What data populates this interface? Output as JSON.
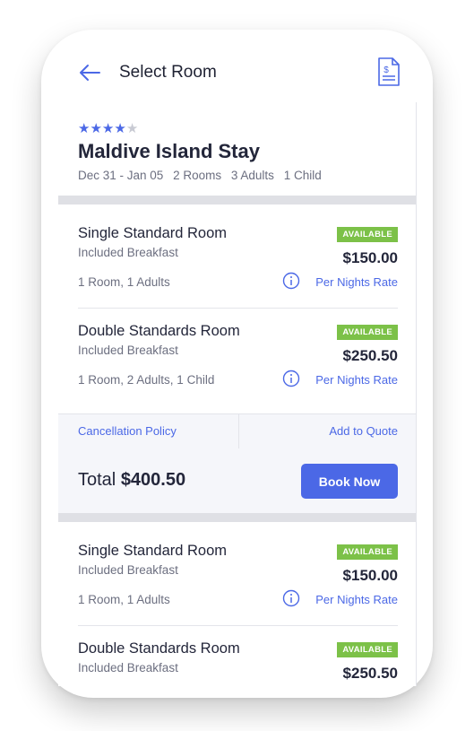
{
  "header": {
    "title": "Select Room"
  },
  "hotel": {
    "rating": 4,
    "max_rating": 5,
    "name": "Maldive Island Stay",
    "dates": "Dec 31 - Jan 05",
    "rooms": "2 Rooms",
    "adults": "3 Adults",
    "children": "1 Child"
  },
  "rooms": [
    {
      "name": "Single Standard Room",
      "sub": "Included Breakfast",
      "badge": "AVAILABLE",
      "price": "$150.00",
      "occupancy": "1 Room, 1 Adults",
      "rate_label": "Per Nights Rate"
    },
    {
      "name": "Double Standards Room",
      "sub": "Included Breakfast",
      "badge": "AVAILABLE",
      "price": "$250.50",
      "occupancy": "1 Room, 2 Adults, 1 Child",
      "rate_label": "Per Nights Rate"
    },
    {
      "name": "Single Standard Room",
      "sub": "Included Breakfast",
      "badge": "AVAILABLE",
      "price": "$150.00",
      "occupancy": "1 Room, 1 Adults",
      "rate_label": "Per Nights Rate"
    },
    {
      "name": "Double Standards Room",
      "sub": "Included Breakfast",
      "badge": "AVAILABLE",
      "price": "$250.50",
      "occupancy": "",
      "rate_label": ""
    }
  ],
  "actions": {
    "cancellation": "Cancellation Policy",
    "add_quote": "Add to Quote"
  },
  "total": {
    "label": "Total",
    "value": "$400.50",
    "book_label": "Book Now"
  },
  "colors": {
    "accent": "#4b68e6",
    "available": "#7cc148"
  }
}
